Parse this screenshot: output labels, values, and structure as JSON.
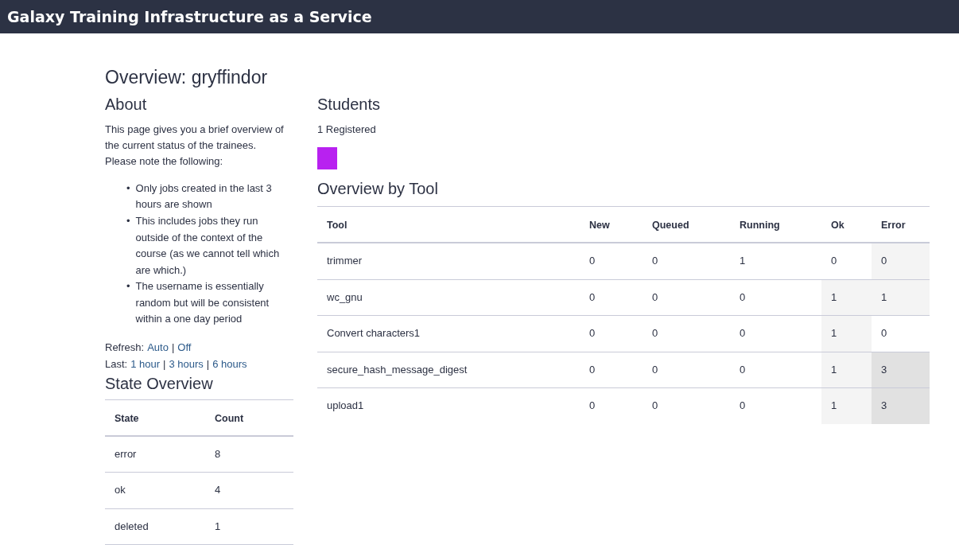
{
  "header": {
    "title": "Galaxy Training Infrastructure as a Service"
  },
  "page_title": "Overview: gryffindor",
  "about": {
    "heading": "About",
    "intro": "This page gives you a brief overview of the current status of the trainees. Please note the following:",
    "notes": [
      {
        "bullet": "•",
        "text": "Only jobs created in the last 3 hours are shown"
      },
      {
        "bullet": "•",
        "text": "This includes jobs they run outside of the context of the course (as we cannot tell which are which.)"
      },
      {
        "bullet": "•",
        "text": "The username is essentially random but will be consistent within a one day period"
      }
    ]
  },
  "refresh": {
    "label": "Refresh:",
    "items": [
      {
        "kind": "link",
        "text": "Auto"
      },
      {
        "kind": "sep",
        "text": "|"
      },
      {
        "kind": "link",
        "text": "Off"
      }
    ]
  },
  "last": {
    "label": "Last:",
    "items": [
      {
        "kind": "link",
        "text": "1 hour"
      },
      {
        "kind": "sep",
        "text": "|"
      },
      {
        "kind": "link",
        "text": "3 hours"
      },
      {
        "kind": "sep",
        "text": "|"
      },
      {
        "kind": "link",
        "text": "6 hours"
      }
    ]
  },
  "state_overview": {
    "heading": "State Overview",
    "columns": [
      "State",
      "Count"
    ],
    "rows": [
      [
        "error",
        "8"
      ],
      [
        "ok",
        "4"
      ],
      [
        "deleted",
        "1"
      ]
    ]
  },
  "students": {
    "heading": "Students",
    "count": "1 Registered",
    "items": [
      {
        "color": "#b821f0"
      }
    ]
  },
  "tool_overview": {
    "heading": "Overview by Tool",
    "columns": [
      "Tool",
      "New",
      "Queued",
      "Running",
      "Ok",
      "Error"
    ],
    "rows": [
      {
        "cells": [
          {
            "text": "trimmer"
          },
          {
            "text": "0"
          },
          {
            "text": "0"
          },
          {
            "text": "1"
          },
          {
            "text": "0"
          },
          {
            "text": "0",
            "color": "#f4f4f4"
          }
        ]
      },
      {
        "cells": [
          {
            "text": "wc_gnu"
          },
          {
            "text": "0"
          },
          {
            "text": "0"
          },
          {
            "text": "0"
          },
          {
            "text": "1",
            "color": "#f4f4f4"
          },
          {
            "text": "1",
            "color": "#f4f4f4"
          }
        ]
      },
      {
        "cells": [
          {
            "text": "Convert characters1"
          },
          {
            "text": "0"
          },
          {
            "text": "0"
          },
          {
            "text": "0"
          },
          {
            "text": "1",
            "color": "#f4f4f4"
          },
          {
            "text": "0"
          }
        ]
      },
      {
        "cells": [
          {
            "text": "secure_hash_message_digest"
          },
          {
            "text": "0"
          },
          {
            "text": "0"
          },
          {
            "text": "0"
          },
          {
            "text": "1",
            "color": "#f4f4f4"
          },
          {
            "text": "3",
            "color": "#e1e1e1"
          }
        ]
      },
      {
        "cells": [
          {
            "text": "upload1"
          },
          {
            "text": "0"
          },
          {
            "text": "0"
          },
          {
            "text": "0"
          },
          {
            "text": "1",
            "color": "#f4f4f4"
          },
          {
            "text": "3",
            "color": "#e1e1e1"
          }
        ]
      }
    ]
  }
}
